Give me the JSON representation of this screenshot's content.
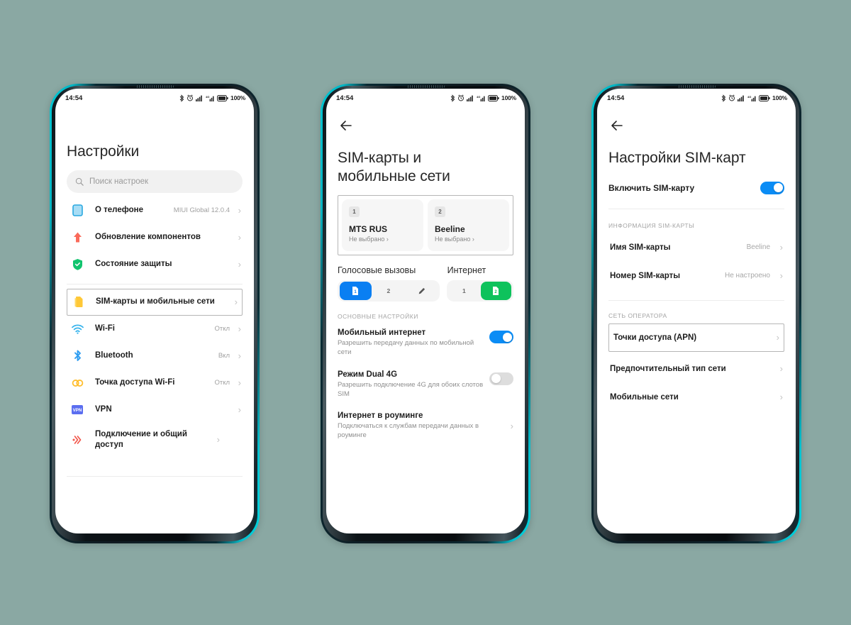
{
  "background_color": "#8aa8a3",
  "accent": {
    "blue": "#0a8cf5",
    "green": "#0ec25c",
    "frame_cyan": "#00c8d4"
  },
  "status_bar": {
    "time": "14:54",
    "battery_percent": "100%",
    "icons": [
      "bluetooth-icon",
      "alarm-icon",
      "signal-sim1-icon",
      "signal-sim2-icon",
      "battery-icon"
    ]
  },
  "screen1": {
    "title": "Настройки",
    "search": {
      "placeholder": "Поиск настроек",
      "icon": "search-icon"
    },
    "group1": [
      {
        "icon": "phone-info-icon",
        "label": "О телефоне",
        "value": "MIUI Global 12.0.4",
        "chevron": "›"
      },
      {
        "icon": "update-arrow-icon",
        "label": "Обновление компонентов",
        "value": "",
        "chevron": "›"
      },
      {
        "icon": "shield-check-icon",
        "label": "Состояние защиты",
        "value": "",
        "chevron": "›"
      }
    ],
    "group2": [
      {
        "icon": "sim-card-icon",
        "label": "SIM-карты и мобильные сети",
        "value": "",
        "chevron": "›",
        "focused": true
      },
      {
        "icon": "wifi-icon",
        "label": "Wi-Fi",
        "value": "Откл",
        "chevron": "›",
        "focused": false
      },
      {
        "icon": "bluetooth-icon",
        "label": "Bluetooth",
        "value": "Вкл",
        "chevron": "›",
        "focused": false
      },
      {
        "icon": "hotspot-icon",
        "label": "Точка доступа Wi-Fi",
        "value": "Откл",
        "chevron": "›",
        "focused": false
      },
      {
        "icon": "vpn-icon",
        "label": "VPN",
        "value": "",
        "chevron": "›",
        "focused": false
      },
      {
        "icon": "sharing-icon",
        "label": "Подключение и общий доступ",
        "value": "",
        "chevron": "›",
        "focused": false
      }
    ]
  },
  "screen2": {
    "back_icon": "back-arrow-icon",
    "title": "SIM-карты и мобильные сети",
    "sim_cards": [
      {
        "badge": "1",
        "name": "MTS RUS",
        "subtitle": "Не выбрано ›"
      },
      {
        "badge": "2",
        "name": "Beeline",
        "subtitle": "Не выбрано ›"
      }
    ],
    "segments": {
      "calls_label": "Голосовые вызовы",
      "data_label": "Интернет",
      "calls_options": [
        {
          "text": "1",
          "state": "selected-blue"
        },
        {
          "text": "2",
          "state": "normal"
        },
        {
          "text": "✎",
          "state": "pencil"
        }
      ],
      "data_options": [
        {
          "text": "1",
          "state": "normal"
        },
        {
          "text": "2",
          "state": "selected-green"
        }
      ]
    },
    "section_label": "ОСНОВНЫЕ НАСТРОЙКИ",
    "items": [
      {
        "title": "Мобильный интернет",
        "desc": "Разрешить передачу данных по мобильной сети",
        "control": "toggle",
        "on": true
      },
      {
        "title": "Режим Dual 4G",
        "desc": "Разрешить подключение 4G для обоих слотов SIM",
        "control": "toggle",
        "on": false
      },
      {
        "title": "Интернет в роуминге",
        "desc": "Подключаться к службам передачи данных в роуминге",
        "control": "chevron",
        "chevron": "›"
      }
    ]
  },
  "screen3": {
    "back_icon": "back-arrow-icon",
    "title": "Настройки SIM-карт",
    "enable": {
      "label": "Включить SIM-карту",
      "on": true
    },
    "section_info_label": "ИНФОРМАЦИЯ SIM-КАРТЫ",
    "info_items": [
      {
        "label": "Имя SIM-карты",
        "value": "Beeline",
        "chevron": "›",
        "focused": false
      },
      {
        "label": "Номер SIM-карты",
        "value": "Не настроено",
        "chevron": "›",
        "focused": false
      }
    ],
    "section_network_label": "СЕТЬ ОПЕРАТОРА",
    "network_items": [
      {
        "label": "Точки доступа (APN)",
        "value": "",
        "chevron": "›",
        "focused": true
      },
      {
        "label": "Предпочтительный тип сети",
        "value": "",
        "chevron": "›",
        "focused": false
      },
      {
        "label": "Мобильные сети",
        "value": "",
        "chevron": "›",
        "focused": false
      }
    ]
  }
}
